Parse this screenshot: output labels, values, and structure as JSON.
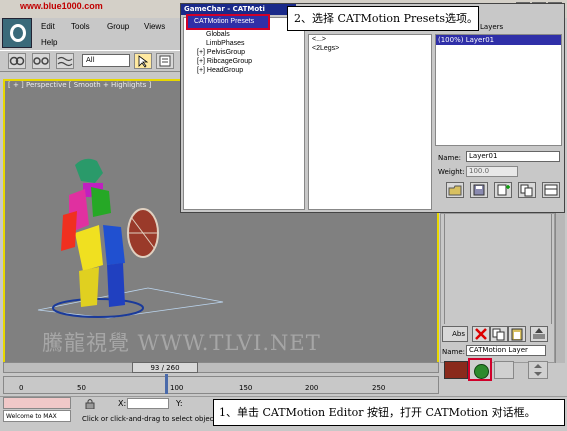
{
  "url_watermark": "www.blue1000.com",
  "menu": {
    "edit": "Edit",
    "tools": "Tools",
    "group": "Group",
    "views": "Views",
    "help": "Help"
  },
  "toolbar": {
    "filter_value": "All"
  },
  "viewport": {
    "label": "[ + ] Perspective [ Smooth + Highlights ]",
    "watermark": "騰龍視覺 WWW.TLVI.NET"
  },
  "dialog": {
    "title": "GameChar - CATMoti",
    "presets_item": "CATMotion Presets",
    "tree_items": [
      "Globals",
      "LimbPhases",
      "[+] PelvisGroup",
      "[+] RibcageGroup",
      "[+] HeadGroup"
    ],
    "mid_items": [
      "<...>",
      "<2Legs>"
    ],
    "layers_header": "Layers",
    "layer_selected": "(100%) Layer01",
    "name_label": "Name:",
    "name_value": "Layer01",
    "weight_label": "Weight:",
    "weight_value": "100.0"
  },
  "callouts": {
    "step2": "2、选择 CATMotion Presets选项。",
    "step1": "1、单击 CATMotion Editor 按钮，打开 CATMotion 对话框。"
  },
  "command_panel": {
    "abs_label": "Abs",
    "name_label": "Name:",
    "name_value": "CATMotion Layer",
    "swatch_color": "#8a2a1c"
  },
  "timeline": {
    "thumb_text": "93 / 260",
    "ticks": [
      "0",
      "50",
      "100",
      "150",
      "200",
      "250"
    ]
  },
  "status": {
    "welcome": "Welcome to MAX",
    "x_label": "X:",
    "y_label": "Y:",
    "message": "Click or click-and-drag to select objects"
  },
  "colors": {
    "accent_red": "#d0002a",
    "selection_blue": "#2f2fa8",
    "viewport_border": "#e8d800"
  }
}
